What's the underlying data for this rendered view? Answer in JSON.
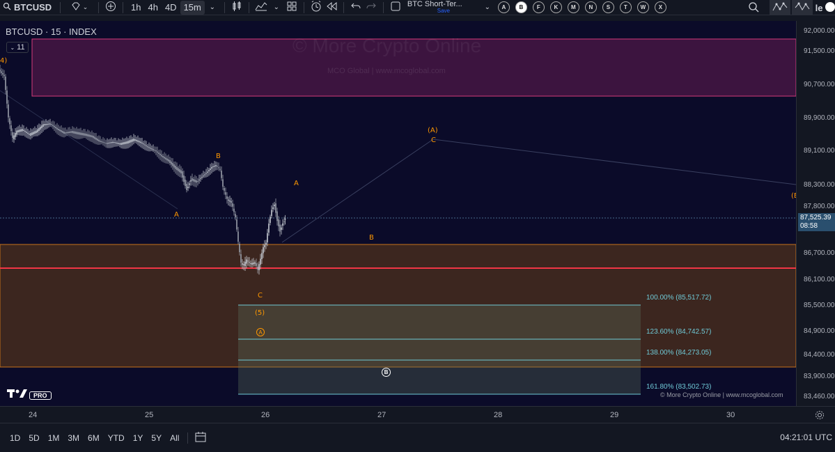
{
  "toolbar": {
    "symbol": "BTCUSD",
    "intervals": [
      "1h",
      "4h",
      "4D",
      "15m"
    ],
    "active_interval": "15m",
    "layout_title": "BTC Short-Ter...",
    "layout_save": "Save",
    "drawing_letters": [
      "A",
      "B",
      "F",
      "K",
      "M",
      "N",
      "S",
      "T",
      "W",
      "X"
    ],
    "selected_letter": "B",
    "edge_text": "le"
  },
  "legend": {
    "title": "BTCUSD · 15 · INDEX",
    "indicator_count": "11"
  },
  "watermark": {
    "main": "© More Crypto Online",
    "sub": "MCO Global  |  www.mcoglobal.com"
  },
  "credit": "© More Crypto Online  |  www.mcoglobal.com",
  "tv_badge": "PRO",
  "price_axis": {
    "labels": [
      "92,000.00",
      "91,500.00",
      "90,700.00",
      "89,900.00",
      "89,100.00",
      "88,300.00",
      "87,800.00",
      "86,700.00",
      "86,100.00",
      "85,500.00",
      "84,900.00",
      "84,400.00",
      "83,900.00",
      "83,460.00"
    ],
    "current_price": "87,525.39",
    "countdown": "08:58"
  },
  "wave_labels": {
    "left_edge": "4)",
    "a1": "A",
    "b1": "B",
    "c1": "C",
    "five": "(5)",
    "a2": "A",
    "b2": "B",
    "big_a": "(A)",
    "c2": "C",
    "right_edge": "(E",
    "circled_a": "A",
    "circled_b": "B"
  },
  "fib_levels": [
    "100.00% (85,517.72)",
    "123.60% (84,742.57)",
    "138.00% (84,273.05)",
    "161.80% (83,502.73)"
  ],
  "time_axis": [
    "24",
    "25",
    "26",
    "27",
    "28",
    "29",
    "30"
  ],
  "bottom": {
    "ranges": [
      "1D",
      "5D",
      "1M",
      "3M",
      "6M",
      "YTD",
      "1Y",
      "5Y",
      "All"
    ],
    "clock": "04:21:01 UTC"
  },
  "colors": {
    "background": "#0b0b29",
    "candle_down": "#9aa0ab",
    "candle_up": "#c7ccd4",
    "wave_orange": "#ff9800",
    "fib_cyan": "#6fc9d6",
    "support_red": "#f23645",
    "resistance_box": "#d63a7a"
  }
}
